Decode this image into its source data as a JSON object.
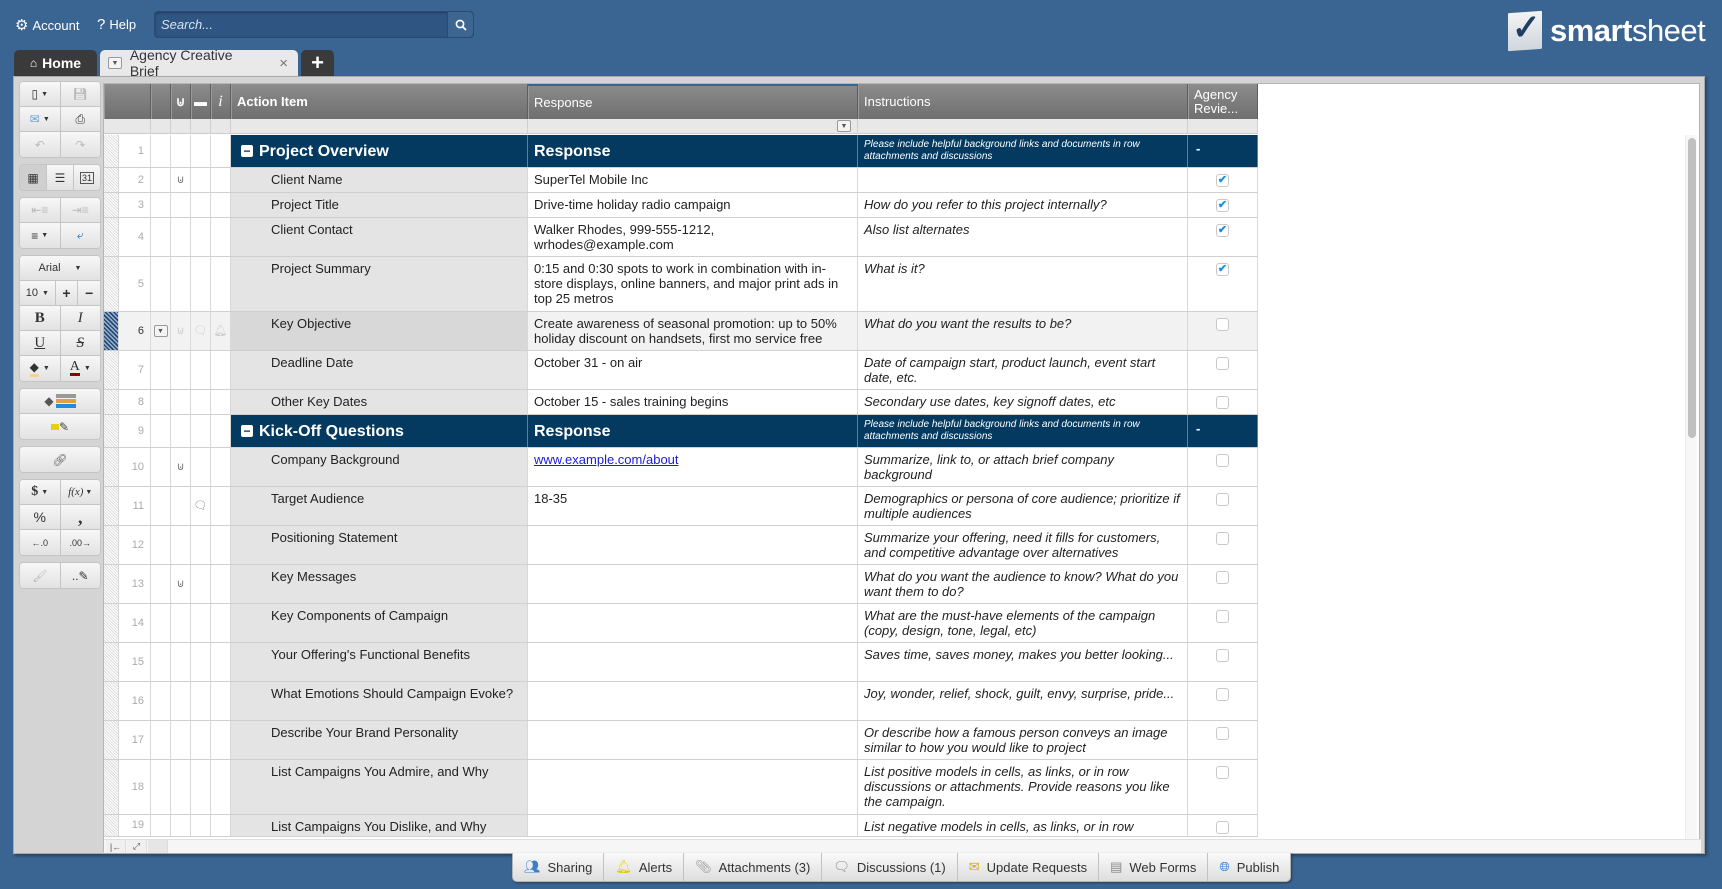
{
  "topbar": {
    "account_label": "Account",
    "help_label": "Help",
    "search_placeholder": "Search...",
    "logo_bold": "smart",
    "logo_light": "sheet"
  },
  "tabs": {
    "home_label": "Home",
    "sheet_label": "Agency Creative Brief",
    "close_glyph": "×",
    "add_glyph": "+"
  },
  "toolbar": {
    "font_name": "Arial",
    "font_size": "10",
    "bold": "B",
    "italic": "I",
    "underline": "U",
    "strike": "S",
    "currency": "$",
    "formula": "f(x)",
    "percent": "%",
    "comma": ",",
    "inc_decimal": "←.0",
    "dec_decimal": ".00→"
  },
  "columns": {
    "action_item": "Action Item",
    "response": "Response",
    "instructions": "Instructions",
    "agency_review": "Agency Revie..."
  },
  "rows": [
    {
      "num": "1",
      "type": "section",
      "action": "Project Overview",
      "response": "Response",
      "instructions": "Please include helpful background links and documents in row attachments and discussions",
      "review": "-"
    },
    {
      "num": "2",
      "action": "Client Name",
      "response": "SuperTel Mobile Inc",
      "instructions": "",
      "checked": true,
      "attach": true
    },
    {
      "num": "3",
      "action": "Project Title",
      "response": "Drive-time holiday radio campaign",
      "instructions": "How do you refer to this project internally?",
      "checked": true
    },
    {
      "num": "4",
      "action": "Client Contact",
      "response": "Walker Rhodes, 999-555-1212, wrhodes@example.com",
      "instructions": "Also list alternates",
      "checked": true
    },
    {
      "num": "5",
      "action": "Project Summary",
      "response": "0:15 and 0:30 spots to work in combination with in-store displays, online banners, and major print ads in top 25 metros",
      "instructions": "What is it?",
      "checked": true
    },
    {
      "num": "6",
      "action": "Key Objective",
      "response": "Create awareness of seasonal promotion: up to 50% holiday discount on handsets, first mo service free",
      "instructions": "What do you want the results to be?",
      "checked": false,
      "selected": true
    },
    {
      "num": "7",
      "action": "Deadline Date",
      "response": "October 31 - on air",
      "instructions": "Date of campaign start, product launch, event start date, etc.",
      "checked": false
    },
    {
      "num": "8",
      "action": "Other Key Dates",
      "response": "October 15 - sales training begins",
      "instructions": "Secondary use dates, key signoff dates, etc",
      "checked": false
    },
    {
      "num": "9",
      "type": "section",
      "action": "Kick-Off Questions",
      "response": "Response",
      "instructions": "Please include helpful background links and documents in row attachments and discussions",
      "review": "-"
    },
    {
      "num": "10",
      "action": "Company Background",
      "response": "www.example.com/about",
      "link": true,
      "instructions": "Summarize, link to, or attach brief company background",
      "checked": false,
      "attach": true
    },
    {
      "num": "11",
      "action": "Target Audience",
      "response": "18-35",
      "instructions": "Demographics or persona of core audience; prioritize if multiple audiences",
      "checked": false,
      "comment": true
    },
    {
      "num": "12",
      "action": "Positioning Statement",
      "response": "",
      "instructions": "Summarize your offering, need it fills for customers, and competitive advantage over alternatives",
      "checked": false
    },
    {
      "num": "13",
      "action": "Key Messages",
      "response": "",
      "instructions": "What do you want the audience to know? What do you want them to do?",
      "checked": false,
      "attach": true
    },
    {
      "num": "14",
      "action": "Key Components of Campaign",
      "response": "",
      "instructions": "What are the must-have elements of the campaign (copy, design, tone, legal, etc)",
      "checked": false
    },
    {
      "num": "15",
      "action": "Your Offering's Functional Benefits",
      "response": "",
      "instructions": "Saves time, saves money, makes you better looking...",
      "checked": false
    },
    {
      "num": "16",
      "action": "What Emotions Should Campaign Evoke?",
      "response": "",
      "instructions": "Joy, wonder, relief, shock, guilt, envy, surprise, pride...",
      "checked": false
    },
    {
      "num": "17",
      "action": "Describe Your Brand Personality",
      "response": "",
      "instructions": "Or describe how a famous person conveys an image similar to how you would like to project",
      "checked": false
    },
    {
      "num": "18",
      "action": "List Campaigns You Admire, and Why",
      "response": "",
      "instructions": "List positive models in cells, as links, or in row discussions or attachments. Provide reasons you like the campaign.",
      "checked": false
    },
    {
      "num": "19",
      "action": "List Campaigns You Dislike, and Why",
      "response": "",
      "instructions": "List negative models in cells, as links, or in row",
      "checked": false
    }
  ],
  "footer": {
    "sharing": "Sharing",
    "alerts": "Alerts",
    "attachments": "Attachments (3)",
    "discussions": "Discussions (1)",
    "update_requests": "Update Requests",
    "web_forms": "Web Forms",
    "publish": "Publish"
  },
  "colors": {
    "background": "#3a6592",
    "section_header": "#043a60",
    "checkbox_check": "#1a8fe0"
  }
}
